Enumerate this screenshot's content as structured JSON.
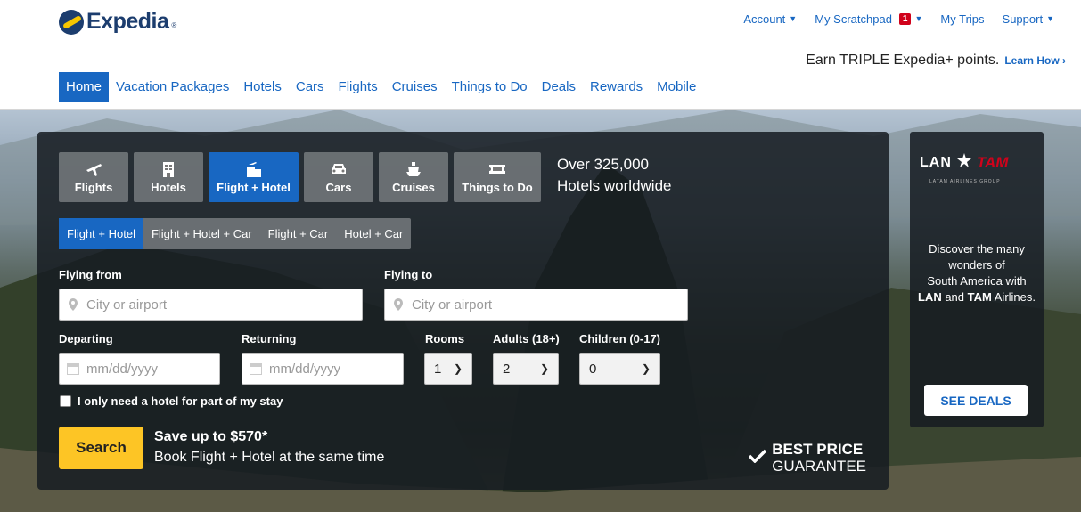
{
  "header": {
    "logo_text": "Expedia",
    "top_links": {
      "account": "Account",
      "scratchpad": "My Scratchpad",
      "scratchpad_count": "1",
      "trips": "My Trips",
      "support": "Support"
    },
    "promo_text": "Earn TRIPLE Expedia+ points.",
    "promo_link": "Learn How"
  },
  "nav": {
    "home": "Home",
    "vacation": "Vacation Packages",
    "hotels": "Hotels",
    "cars": "Cars",
    "flights": "Flights",
    "cruises": "Cruises",
    "things": "Things to Do",
    "deals": "Deals",
    "rewards": "Rewards",
    "mobile": "Mobile"
  },
  "search": {
    "tabs": {
      "flights": "Flights",
      "hotels": "Hotels",
      "flight_hotel": "Flight + Hotel",
      "cars": "Cars",
      "cruises": "Cruises",
      "things": "Things to Do"
    },
    "tagline_1": "Over 325,000",
    "tagline_2": "Hotels worldwide",
    "subtabs": {
      "fh": "Flight + Hotel",
      "fhc": "Flight + Hotel + Car",
      "fc": "Flight + Car",
      "hc": "Hotel + Car"
    },
    "flying_from": {
      "label": "Flying from",
      "placeholder": "City or airport"
    },
    "flying_to": {
      "label": "Flying to",
      "placeholder": "City or airport"
    },
    "departing": {
      "label": "Departing",
      "placeholder": "mm/dd/yyyy"
    },
    "returning": {
      "label": "Returning",
      "placeholder": "mm/dd/yyyy"
    },
    "rooms": {
      "label": "Rooms",
      "value": "1"
    },
    "adults": {
      "label": "Adults (18+)",
      "value": "2"
    },
    "children": {
      "label": "Children (0-17)",
      "value": "0"
    },
    "partial_stay": "I only need a hotel for part of my stay",
    "button": "Search",
    "save_title": "Save up to $570*",
    "save_sub": "Book Flight + Hotel at the same time",
    "guarantee_1": "BEST PRICE",
    "guarantee_2": "GUARANTEE"
  },
  "ad": {
    "lan": "LAN",
    "tam": "TAM",
    "group": "LATAM AIRLINES GROUP",
    "text_1": "Discover the many",
    "text_2": "wonders of",
    "text_3": "South America with",
    "text_lan": "LAN",
    "text_and": "and",
    "text_tam": "TAM",
    "text_end": "Airlines.",
    "button": "SEE DEALS"
  },
  "colors": {
    "brand_blue": "#1867c2",
    "search_yellow": "#fdc525",
    "logo_navy": "#1c3d6e",
    "badge_red": "#d0021b"
  }
}
